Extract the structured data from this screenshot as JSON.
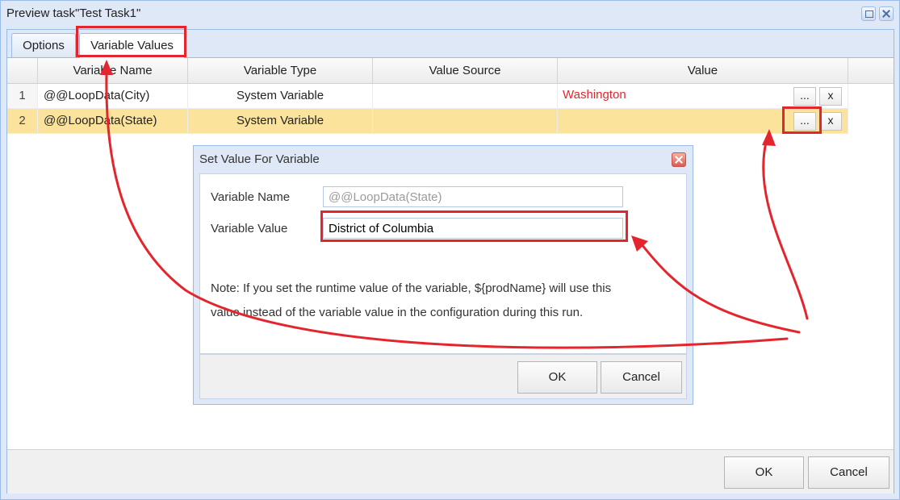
{
  "window": {
    "title": "Preview task\"Test Task1\""
  },
  "tabs": [
    {
      "label": "Options",
      "active": false
    },
    {
      "label": "Variable Values",
      "active": true
    }
  ],
  "grid": {
    "columns": [
      "Variable Name",
      "Variable Type",
      "Value Source",
      "Value"
    ],
    "rows": [
      {
        "num": "1",
        "name": "@@LoopData(City)",
        "type": "System Variable",
        "source": "",
        "value": "Washington",
        "edit_btn": "...",
        "clear_btn": "x"
      },
      {
        "num": "2",
        "name": "@@LoopData(State)",
        "type": "System Variable",
        "source": "",
        "value": "",
        "edit_btn": "...",
        "clear_btn": "x"
      }
    ],
    "value_color": "#e3262d",
    "selected_row_color": "#fbe39c"
  },
  "footer": {
    "ok_label": "OK",
    "cancel_label": "Cancel"
  },
  "dialog": {
    "title": "Set Value For Variable",
    "name_label": "Variable Name",
    "name_value": "@@LoopData(State)",
    "value_label": "Variable Value",
    "value_value": "District of Columbia",
    "note_line1": "Note: If you set the runtime value of the variable, ${prodName} will use this",
    "note_line2": "value instead of the variable value in the configuration during this run.",
    "ok_label": "OK",
    "cancel_label": "Cancel"
  },
  "annotation": {
    "color": "#e3262d",
    "icons": [
      "highlight-box",
      "arrow"
    ]
  }
}
